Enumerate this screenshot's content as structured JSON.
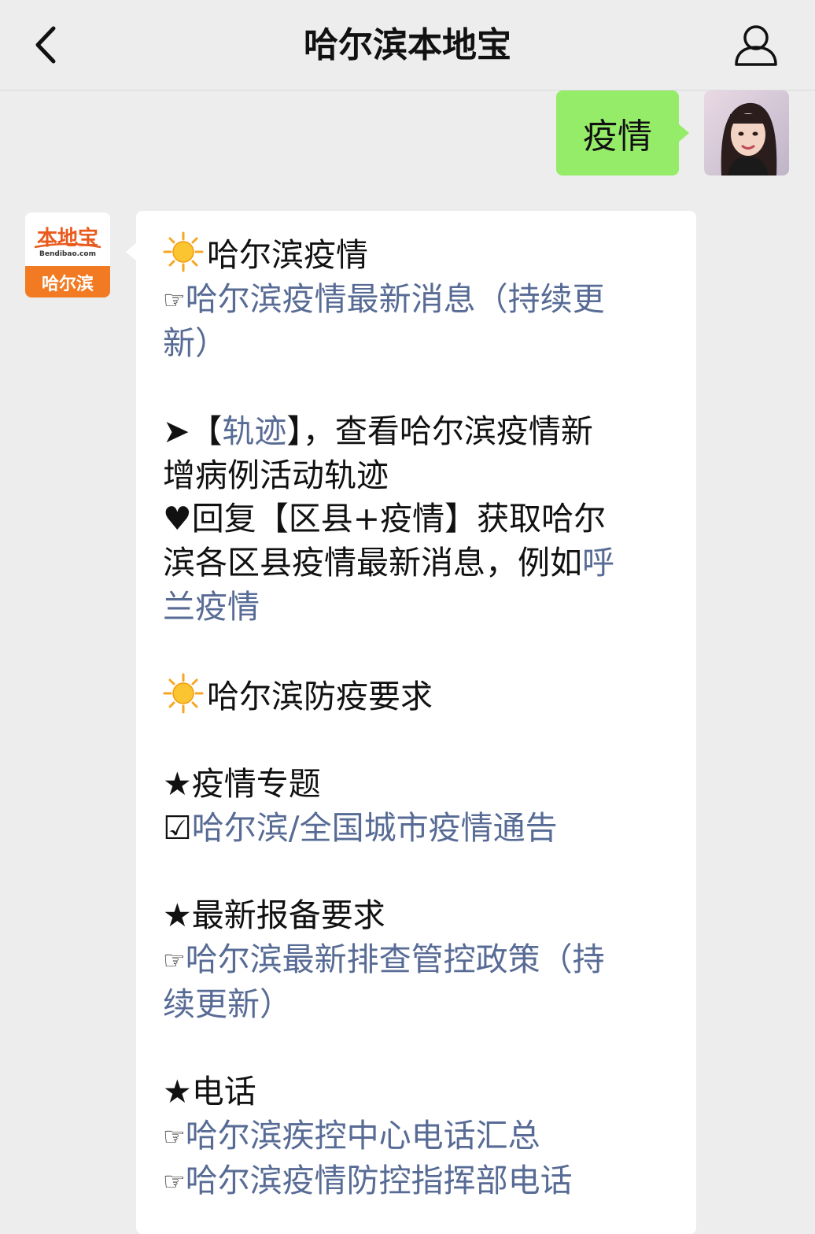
{
  "header": {
    "title": "哈尔滨本地宝"
  },
  "outgoing": {
    "text": "疫情"
  },
  "bot": {
    "avatar_brand": "本地宝",
    "avatar_domain": "Bendibao.com",
    "avatar_city": "哈尔滨"
  },
  "message": {
    "s1_title": "哈尔滨疫情",
    "s1_link_a": "哈尔滨疫情最新消息（持续更",
    "s1_link_b": "新）",
    "track_pre": "➤【",
    "track_link": "轨迹",
    "track_post": "】，查看哈尔滨疫情新",
    "track_line2": "增病例活动轨迹",
    "reply_line1": "♥回复【区县+疫情】获取哈尔",
    "reply_line2_text": "滨各区县疫情最新消息，例如",
    "reply_line2_link": "呼",
    "reply_line3_link": "兰疫情",
    "s2_title": "哈尔滨防疫要求",
    "topic_title": "★疫情专题",
    "topic_check": "☑",
    "topic_link": "哈尔滨/全国城市疫情通告",
    "report_title": "★最新报备要求",
    "report_link_a": "哈尔滨最新排查管控政策（持",
    "report_link_b": "续更新）",
    "phone_title": "★电话",
    "phone_link_1": "哈尔滨疾控中心电话汇总",
    "phone_link_2": "哈尔滨疫情防控指挥部电话",
    "hand_glyph": "☞"
  },
  "colors": {
    "background": "#ededed",
    "outgoing_bubble": "#95ec69",
    "incoming_bubble": "#ffffff",
    "link": "#576b95",
    "brand_orange": "#f27a22"
  },
  "icons": [
    "back-arrow-icon",
    "profile-icon",
    "sun-icon",
    "pointing-hand-icon",
    "checkbox-icon",
    "star-icon",
    "heart-icon"
  ]
}
